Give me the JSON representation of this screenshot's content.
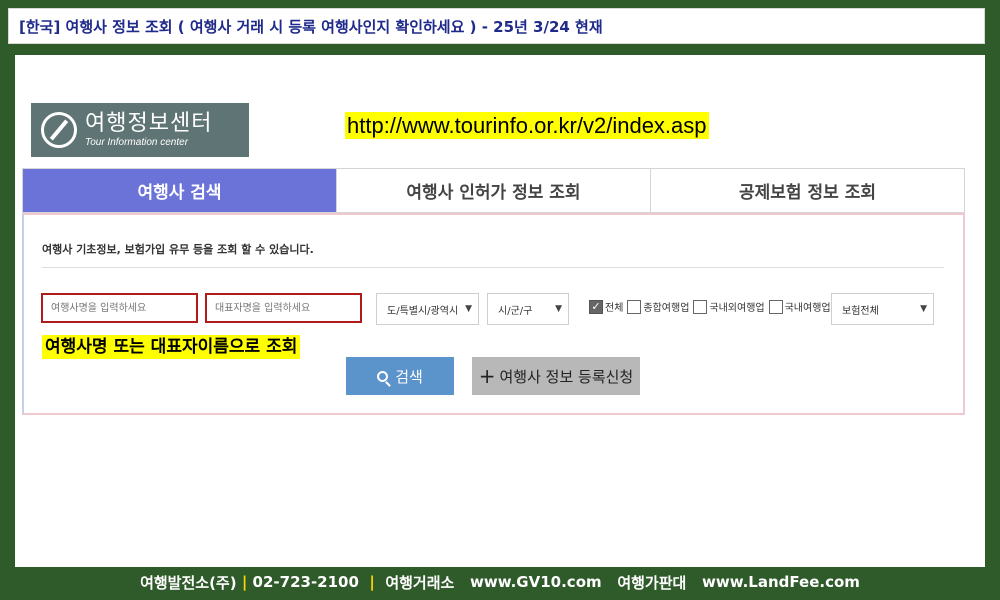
{
  "header": {
    "title": "[한국] 여행사 정보 조회 ( 여행사 거래 시 등록 여행사인지 확인하세요 ) - 25년 3/24 현재"
  },
  "logo": {
    "name_ko": "여행정보센터",
    "name_en": "Tour Information center",
    "icon": "compass-icon"
  },
  "url": "http://www.tourinfo.or.kr/v2/index.asp",
  "tabs": [
    {
      "label": "여행사 검색",
      "active": true
    },
    {
      "label": "여행사 인허가 정보 조회",
      "active": false
    },
    {
      "label": "공제보험 정보 조회",
      "active": false
    }
  ],
  "search": {
    "info_text": "여행사 기초정보, 보험가입 유무 등을 조회 할 수 있습니다.",
    "agency_placeholder": "여행사명을 입력하세요",
    "rep_placeholder": "대표자명을 입력하세요",
    "region_select": "도/특별시/광역시",
    "city_select": "시/군/구",
    "checkboxes": [
      {
        "label": "전체",
        "checked": true
      },
      {
        "label": "종합여행업",
        "checked": false
      },
      {
        "label": "국내외여행업",
        "checked": false
      },
      {
        "label": "국내여행업",
        "checked": false
      }
    ],
    "insurance_select": "보험전체",
    "note": "여행사명 또는 대표자이름으로 조회",
    "search_button": "검색",
    "register_button": "여행사 정보 등록신청"
  },
  "footer": {
    "company": "여행발전소(주)",
    "phone": "02-723-2100",
    "sep": "|",
    "site1_label": "여행거래소",
    "site1_url": "www.GV10.com",
    "site2_label": "여행가판대",
    "site2_url": "www.LandFee.com"
  },
  "colors": {
    "background": "#2f5a2a",
    "active_tab": "#6b72d8",
    "search_button": "#5b93cb",
    "highlight": "#ffff00",
    "input_border": "#b01c1c"
  }
}
